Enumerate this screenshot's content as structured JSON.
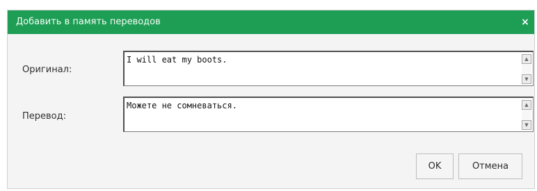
{
  "dialog": {
    "title": "Добавить в память переводов",
    "close_label": "×"
  },
  "fields": {
    "original": {
      "label": "Оригинал:",
      "value": "I will eat my boots."
    },
    "translation": {
      "label": "Перевод:",
      "value": "Можете не сомневаться."
    }
  },
  "buttons": {
    "ok_label": "OK",
    "cancel_label": "Отмена"
  },
  "icons": {
    "scroll_up": "▲",
    "scroll_down": "▼"
  },
  "colors": {
    "titlebar": "#1e9e55"
  }
}
